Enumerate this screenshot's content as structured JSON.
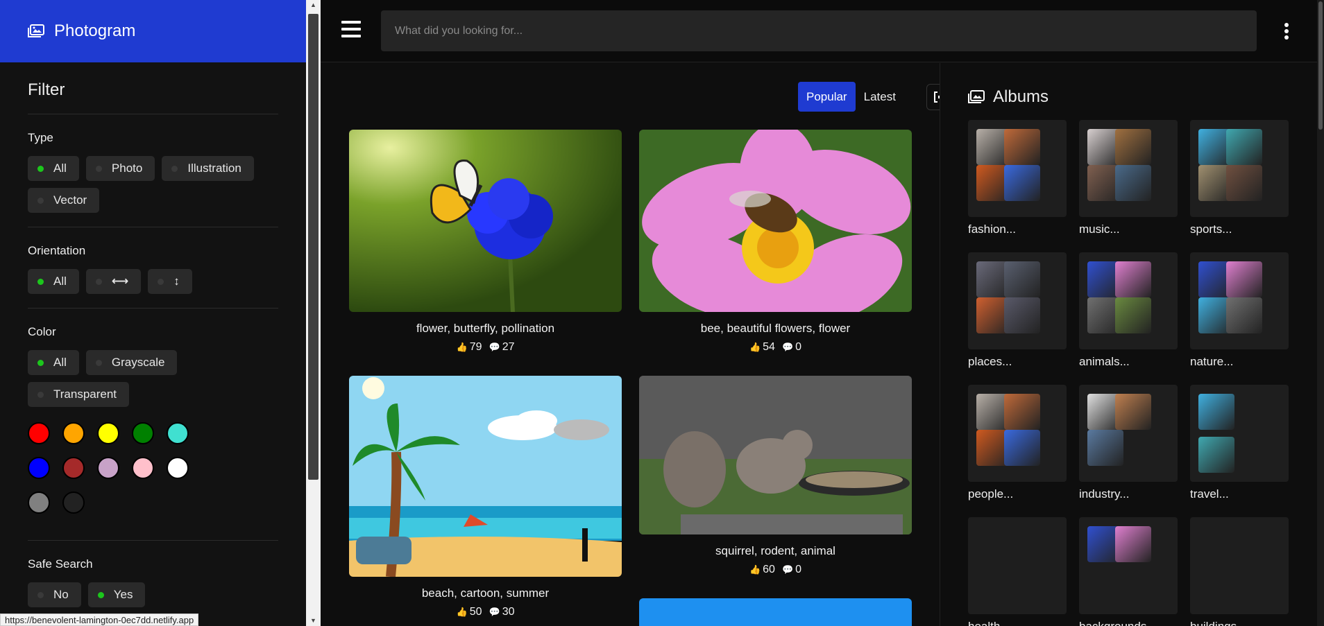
{
  "brand": {
    "name": "Photogram"
  },
  "filter": {
    "title": "Filter",
    "type": {
      "label": "Type",
      "options": [
        "All",
        "Photo",
        "Illustration",
        "Vector"
      ]
    },
    "orientation": {
      "label": "Orientation",
      "all": "All",
      "horizontal_glyph": "⟷",
      "vertical_glyph": "↕"
    },
    "color": {
      "label": "Color",
      "options": [
        "All",
        "Grayscale",
        "Transparent"
      ],
      "swatches": [
        "#ff0000",
        "#ffa500",
        "#ffff00",
        "#008000",
        "#40e0d0",
        "#0000ff",
        "#a52a2a",
        "#c8a2c8",
        "#ffc0cb",
        "#ffffff",
        "#808080",
        "#222222"
      ]
    },
    "safe_search": {
      "label": "Safe Search",
      "options": [
        "No",
        "Yes"
      ]
    }
  },
  "search": {
    "placeholder": "What did you looking for..."
  },
  "tabs": {
    "popular": "Popular",
    "latest": "Latest"
  },
  "photos": [
    {
      "caption": "flower, butterfly, pollination",
      "likes": "79",
      "comments": "27"
    },
    {
      "caption": "bee, beautiful flowers, flower",
      "likes": "54",
      "comments": "0"
    },
    {
      "caption": "beach, cartoon, summer",
      "likes": "50",
      "comments": "30"
    },
    {
      "caption": "squirrel, rodent, animal",
      "likes": "60",
      "comments": "0"
    }
  ],
  "albums": {
    "title": "Albums",
    "items": [
      "fashion...",
      "music...",
      "sports...",
      "places...",
      "animals...",
      "nature...",
      "people...",
      "industry...",
      "travel...",
      "health...",
      "backgrounds...",
      "buildings..."
    ]
  },
  "status_url": "https://benevolent-lamington-0ec7dd.netlify.app",
  "colors": {
    "accent": "#1f3bd1",
    "active_dot": "#1cc61c"
  }
}
